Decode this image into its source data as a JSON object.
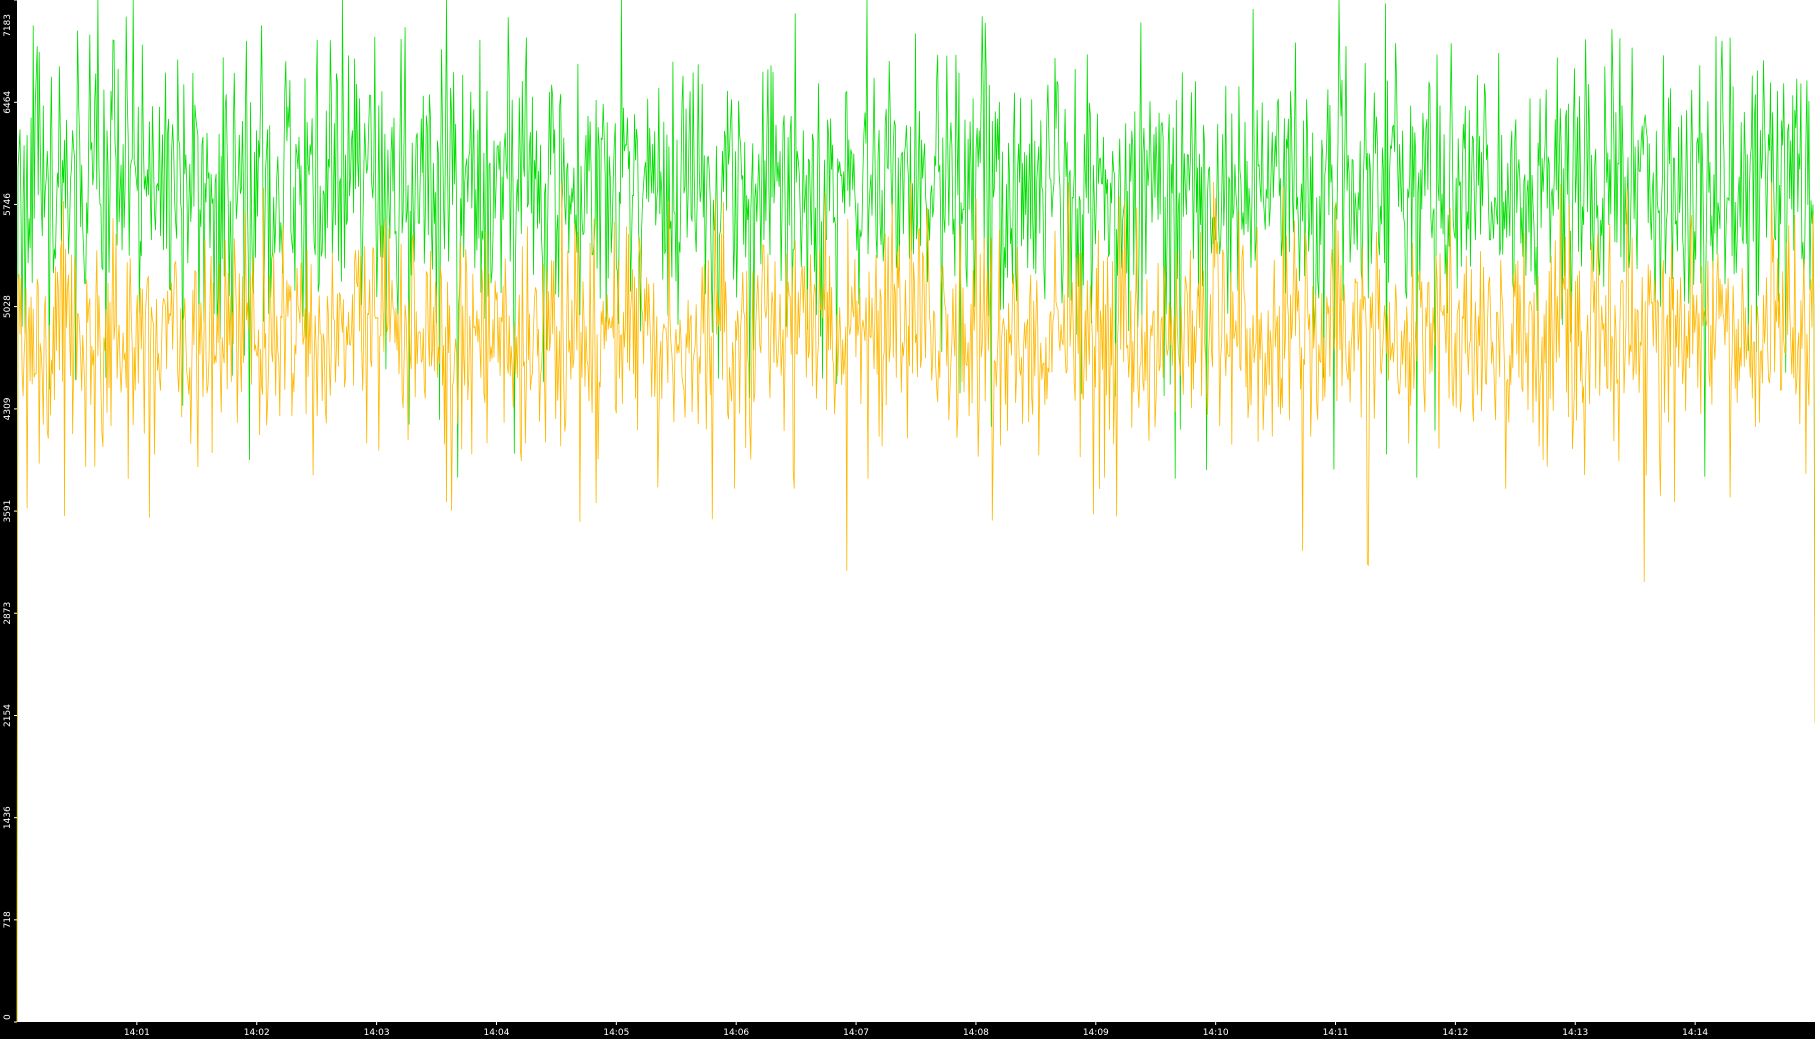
{
  "chart_data": {
    "type": "line",
    "background": "#000000",
    "plot_background": "#ffffff",
    "grid": false,
    "ylim": [
      0,
      7183
    ],
    "y_ticks": [
      "0",
      "718",
      "1436",
      "2154",
      "2873",
      "3591",
      "4309",
      "5028",
      "5746",
      "6464",
      "7183"
    ],
    "x_range": [
      "14:00:00",
      "14:15:00"
    ],
    "x_ticks": [
      "14:01",
      "14:02",
      "14:03",
      "14:04",
      "14:05",
      "14:06",
      "14:07",
      "14:08",
      "14:09",
      "14:10",
      "14:11",
      "14:12",
      "14:13",
      "14:14"
    ],
    "series": [
      {
        "color": "#00dd00",
        "typical_range": [
          5000,
          6900
        ],
        "mean": 5900,
        "min": 3800,
        "max": 7183,
        "end_value": 2450
      },
      {
        "color": "#ffb800",
        "typical_range": [
          4100,
          5600
        ],
        "mean": 4850,
        "min": 3050,
        "max": 5900,
        "end_value": 2100
      }
    ]
  }
}
